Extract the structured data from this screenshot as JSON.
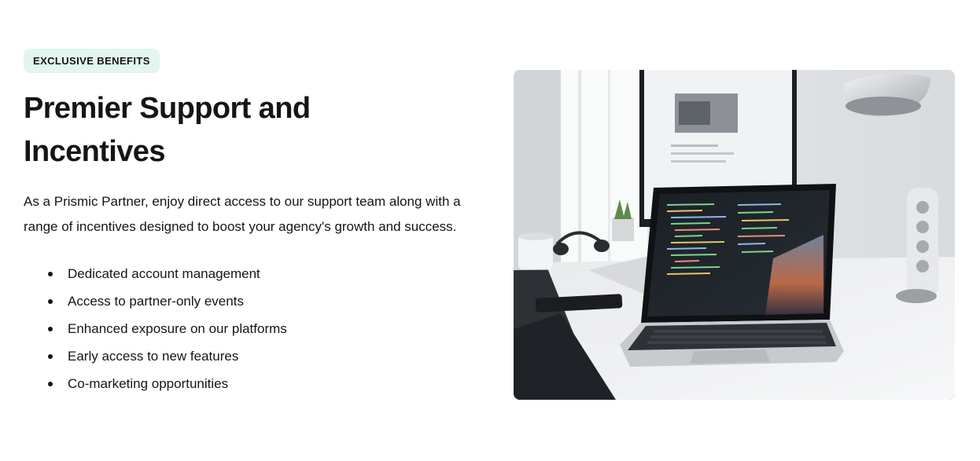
{
  "badge": "EXCLUSIVE BENEFITS",
  "heading": "Premier Support and Incentives",
  "description": "As a Prismic Partner, enjoy direct access to our support team along with a range of incentives designed to boost your agency's growth and success.",
  "benefits": [
    "Dedicated account management",
    "Access to partner-only events",
    "Enhanced exposure on our platforms",
    "Early access to new features",
    "Co-marketing opportunities"
  ],
  "colors": {
    "badge_bg": "#e2f5ef",
    "text": "#151515"
  },
  "image": {
    "alt_icon": "laptop-desk-photo"
  }
}
